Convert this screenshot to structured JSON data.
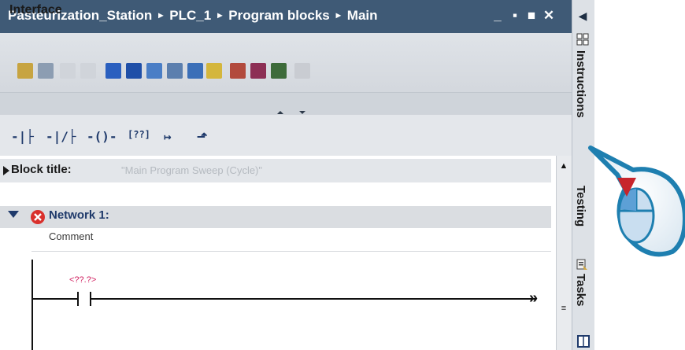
{
  "titlebar": {
    "breadcrumb": [
      "Pasteurization_Station",
      "PLC_1",
      "Program blocks",
      "Main"
    ],
    "separator": "▸",
    "minimize": "_",
    "restore": "▪",
    "maximize": "■",
    "close": "✕"
  },
  "interface": {
    "label": "Interface"
  },
  "ladder_instructions": [
    {
      "name": "normally-open-contact",
      "glyph": "-|├"
    },
    {
      "name": "normally-closed-contact",
      "glyph": "-|/├"
    },
    {
      "name": "coil",
      "glyph": "-()-"
    },
    {
      "name": "empty-box",
      "glyph": "[??]"
    },
    {
      "name": "open-branch",
      "glyph": "↦"
    },
    {
      "name": "close-branch",
      "glyph": "⬏"
    }
  ],
  "block": {
    "title_label": "Block title:",
    "title_value": "\"Main Program Sweep (Cycle)\""
  },
  "network": {
    "title": "Network 1:",
    "comment": "Comment",
    "contact_operand": "<??.?>",
    "end_arrow": "»"
  },
  "scrollbar": {
    "up": "▲",
    "grip": "≡"
  },
  "side_tabs": {
    "collapse": "◀",
    "instructions": "Instructions",
    "testing": "Testing",
    "tasks": "Tasks"
  },
  "colors": {
    "titlebar": "#3f5a76",
    "network_title": "#1f3a6b",
    "error_icon": "#d9302c",
    "callout_accent": "#1e7fb0",
    "operand_placeholder": "#d02060"
  }
}
